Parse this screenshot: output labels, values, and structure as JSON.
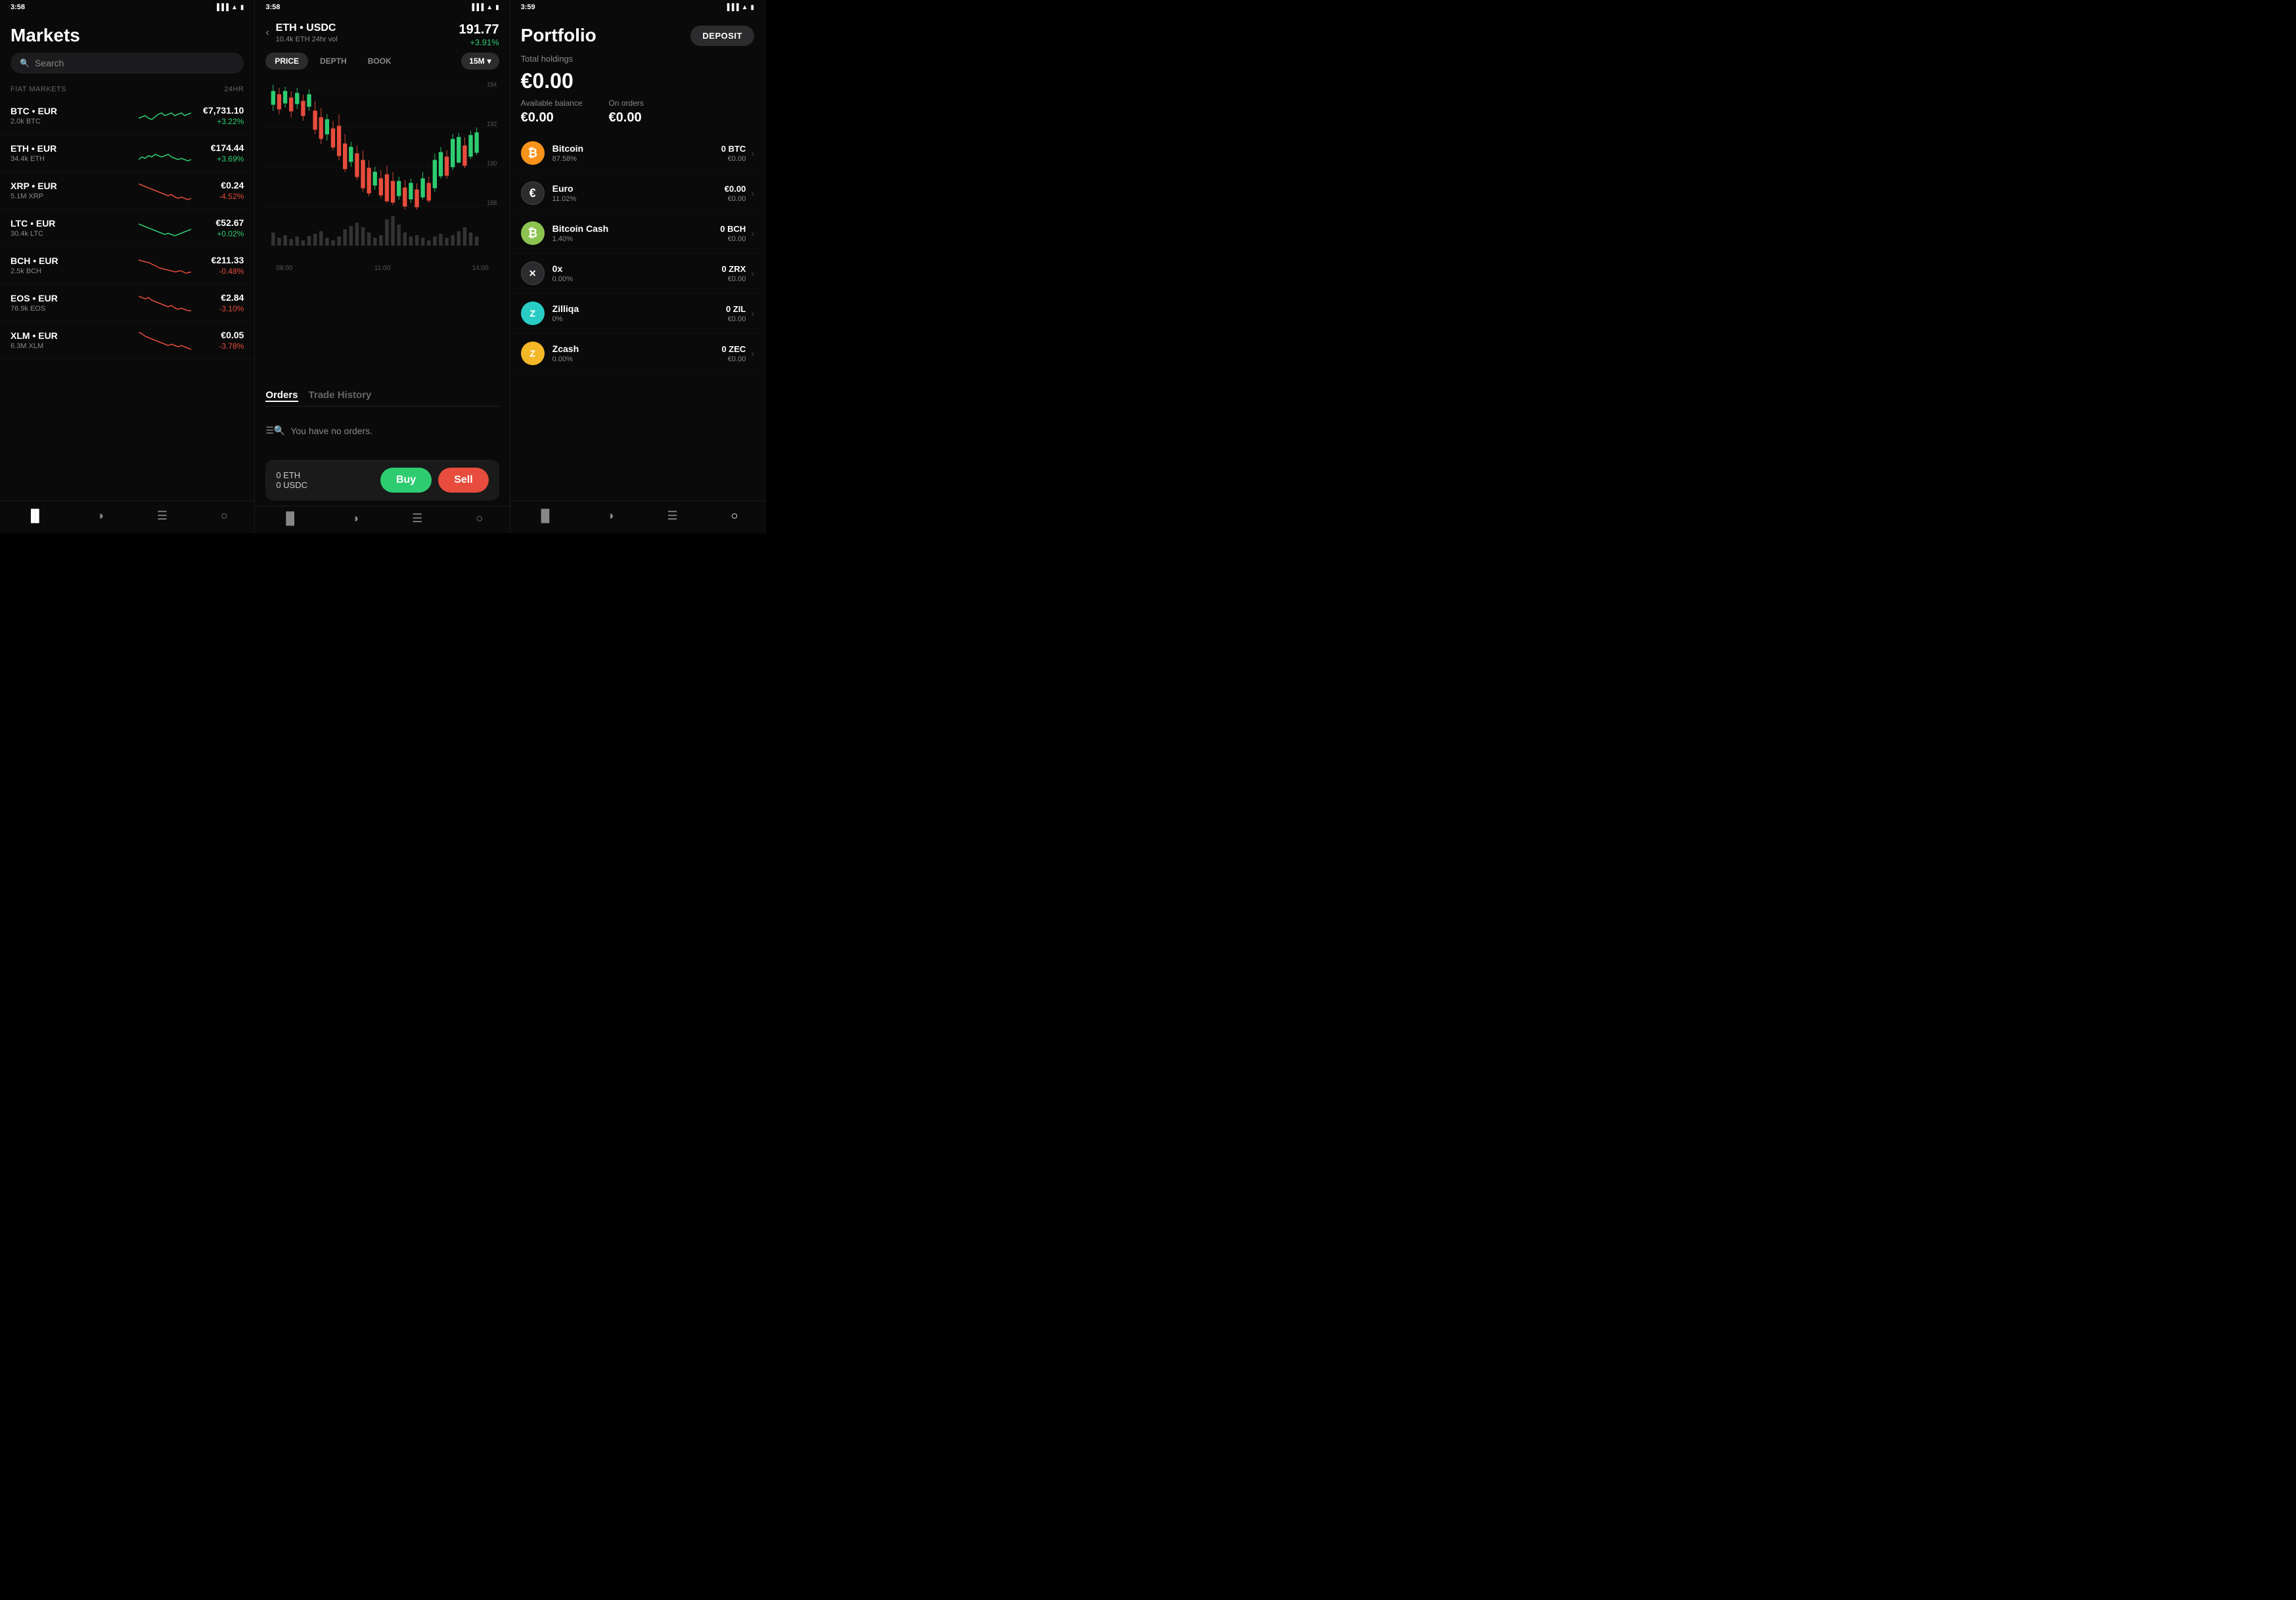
{
  "app": {
    "panels": [
      "markets",
      "chart",
      "portfolio"
    ]
  },
  "status_bars": [
    {
      "time": "3:58",
      "location": true
    },
    {
      "time": "3:58",
      "location": true
    },
    {
      "time": "3:59",
      "location": true
    }
  ],
  "markets": {
    "title": "Markets",
    "search_placeholder": "Search",
    "sections": [
      {
        "name": "FIAT MARKETS",
        "label_24hr": "24HR",
        "items": [
          {
            "pair": "BTC • EUR",
            "volume": "2.0k BTC",
            "price": "€7,731.10",
            "change": "+3.22%",
            "positive": true
          },
          {
            "pair": "ETH • EUR",
            "volume": "34.4k ETH",
            "price": "€174.44",
            "change": "+3.69%",
            "positive": true
          },
          {
            "pair": "XRP • EUR",
            "volume": "5.1M XRP",
            "price": "€0.24",
            "change": "-4.52%",
            "positive": false
          },
          {
            "pair": "LTC • EUR",
            "volume": "30.4k LTC",
            "price": "€52.67",
            "change": "+0.02%",
            "positive": true
          },
          {
            "pair": "BCH • EUR",
            "volume": "2.5k BCH",
            "price": "€211.33",
            "change": "-0.48%",
            "positive": false
          },
          {
            "pair": "EOS • EUR",
            "volume": "76.9k EOS",
            "price": "€2.84",
            "change": "-3.10%",
            "positive": false
          },
          {
            "pair": "XLM • EUR",
            "volume": "6.3M XLM",
            "price": "€0.05",
            "change": "-3.78%",
            "positive": false
          }
        ]
      }
    ],
    "nav_icons": [
      "bar-chart",
      "pie-chart",
      "list",
      "person"
    ]
  },
  "chart": {
    "pair": "ETH • USDC",
    "volume": "10.4k ETH 24hr vol",
    "price": "191.77",
    "change": "+3.91%",
    "tabs": [
      "PRICE",
      "DEPTH",
      "BOOK"
    ],
    "active_tab": "PRICE",
    "timeframe": "15M",
    "price_levels": [
      "194",
      "192",
      "190",
      "188"
    ],
    "time_labels": [
      "08:00",
      "11:00",
      "14:00"
    ],
    "orders_tab_active": "Orders",
    "orders_tab_inactive": "Trade History",
    "no_orders_text": "You have no orders.",
    "eth_balance": "0 ETH",
    "usdc_balance": "0 USDC",
    "buy_label": "Buy",
    "sell_label": "Sell"
  },
  "portfolio": {
    "title": "Portfolio",
    "deposit_label": "DEPOSIT",
    "holdings_label": "Total holdings",
    "total": "€0.00",
    "available_label": "Available balance",
    "available": "€0.00",
    "on_orders_label": "On orders",
    "on_orders": "€0.00",
    "assets": [
      {
        "name": "Bitcoin",
        "pct": "87.58%",
        "crypto": "0 BTC",
        "fiat": "€0.00",
        "icon": "btc",
        "symbol": "₿"
      },
      {
        "name": "Euro",
        "pct": "11.02%",
        "crypto": "€0.00",
        "fiat": "€0.00",
        "icon": "eur",
        "symbol": "€"
      },
      {
        "name": "Bitcoin Cash",
        "pct": "1.40%",
        "crypto": "0 BCH",
        "fiat": "€0.00",
        "icon": "bch",
        "symbol": "₿"
      },
      {
        "name": "0x",
        "pct": "0.00%",
        "crypto": "0 ZRX",
        "fiat": "€0.00",
        "icon": "zrx",
        "symbol": "×"
      },
      {
        "name": "Zilliqa",
        "pct": "0%",
        "crypto": "0 ZIL",
        "fiat": "€0.00",
        "icon": "zil",
        "symbol": "Z"
      },
      {
        "name": "Zcash",
        "pct": "0.00%",
        "crypto": "0 ZEC",
        "fiat": "€0.00",
        "icon": "zec",
        "symbol": "ⓩ"
      }
    ],
    "nav_icons": [
      "bar-chart",
      "pie-chart",
      "list",
      "person"
    ]
  }
}
